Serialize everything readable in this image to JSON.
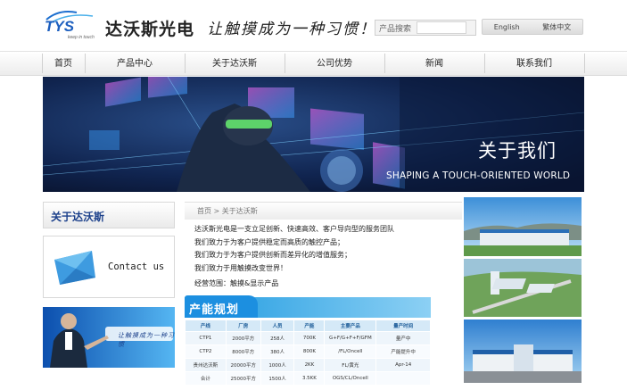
{
  "header": {
    "logo_text": "TYS",
    "logo_tagline": "keep in touch",
    "brand_name": "达沃斯光电",
    "slogan": "让触摸成为一种习惯！",
    "search": {
      "label": "产品搜索",
      "value": ""
    },
    "languages": [
      "English",
      "繁体中文"
    ]
  },
  "nav": {
    "items": [
      {
        "label": "首页"
      },
      {
        "label": "产品中心"
      },
      {
        "label": "关于达沃斯"
      },
      {
        "label": "公司优势"
      },
      {
        "label": "新闻"
      },
      {
        "label": "联系我们"
      }
    ]
  },
  "banner": {
    "title": "关于我们",
    "subtitle": "SHAPING A TOUCH-ORIENTED WORLD"
  },
  "sidebar": {
    "heading": "关于达沃斯",
    "contact_label": "Contact us",
    "promo_text": "让触摸成为一种习惯"
  },
  "main": {
    "breadcrumb": "首页 > 关于达沃斯",
    "intro_lines": [
      "达沃斯光电是一支立足创新、快速高效、客户导向型的服务团队",
      "我们致力于为客户提供稳定而高质的触控产品；",
      "我们致力于为客户提供创新而差异化的增值服务；",
      "我们致力于用触摸改变世界！"
    ],
    "scope": "经营范围：触摸&显示产品",
    "capacity": {
      "title": "产能规划",
      "headers": [
        "产线",
        "厂房",
        "人员",
        "产能",
        "主要产品",
        "量产时间"
      ],
      "rows": [
        [
          "CTP1",
          "2000平方",
          "258人",
          "700K",
          "G+F/G+F+F/GFM",
          "量产中"
        ],
        [
          "CTP2",
          "8000平方",
          "380人",
          "800K",
          "/FL/Oncell",
          "产能提升中"
        ],
        [
          "贵州达沃斯",
          "20000平方",
          "1000人",
          "2KK",
          "FL/黄光",
          "Apr-14"
        ],
        [
          "合计",
          "25000平方",
          "1500人",
          "3.5KK",
          "OGS/CL/Oncell",
          ""
        ]
      ]
    }
  },
  "colors": {
    "brand_blue": "#1a3f8a",
    "capacity_blue": "#1c8fe0",
    "table_header_bg": "#d5e9f7"
  }
}
